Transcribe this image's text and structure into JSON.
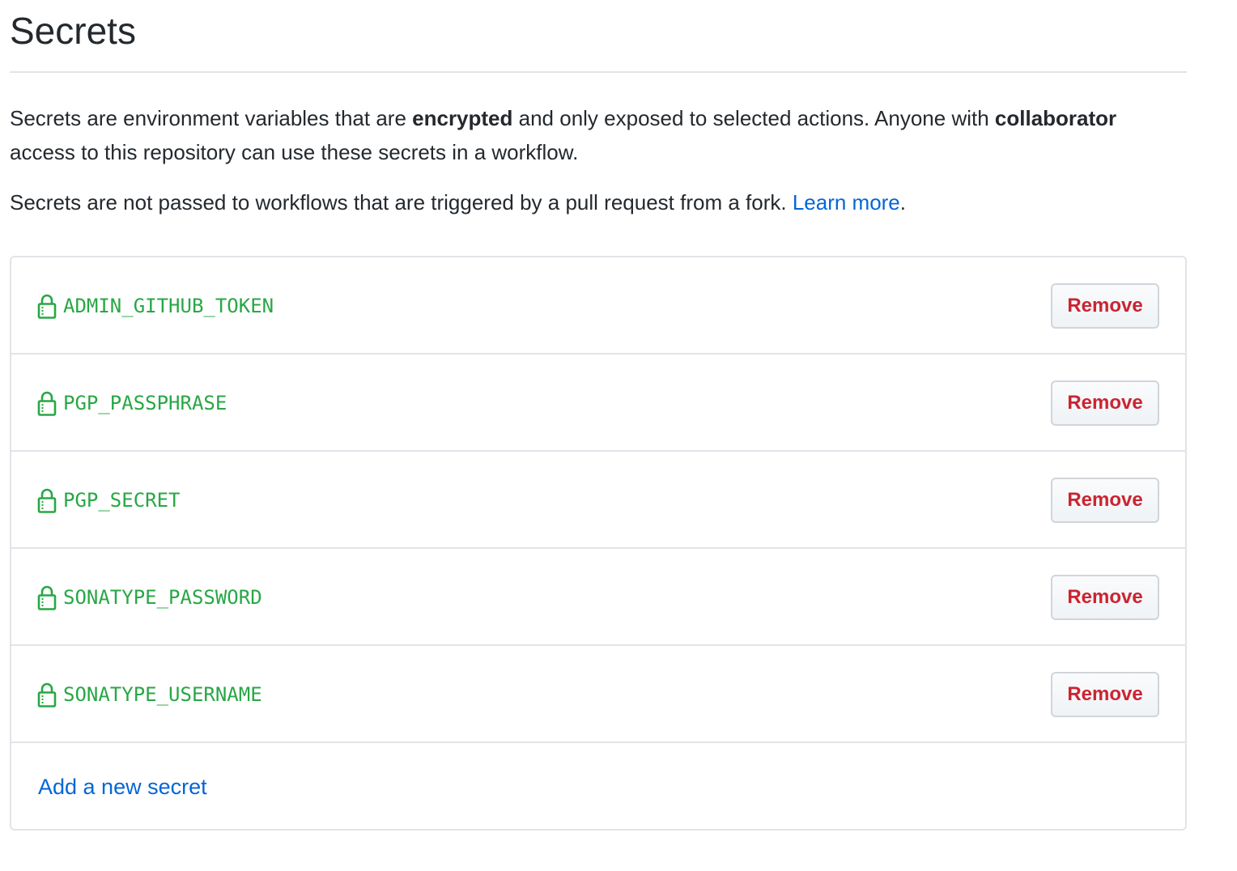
{
  "page": {
    "title": "Secrets"
  },
  "description": {
    "p1_part1": "Secrets are environment variables that are ",
    "p1_bold1": "encrypted",
    "p1_part2": " and only exposed to selected actions. Anyone with ",
    "p1_bold2": "collaborator",
    "p1_part3": " access to this repository can use these secrets in a workflow.",
    "p2_text": "Secrets are not passed to workflows that are triggered by a pull request from a fork. ",
    "p2_link": "Learn more",
    "p2_end": "."
  },
  "secrets": [
    {
      "name": "ADMIN_GITHUB_TOKEN",
      "remove_label": "Remove"
    },
    {
      "name": "PGP_PASSPHRASE",
      "remove_label": "Remove"
    },
    {
      "name": "PGP_SECRET",
      "remove_label": "Remove"
    },
    {
      "name": "SONATYPE_PASSWORD",
      "remove_label": "Remove"
    },
    {
      "name": "SONATYPE_USERNAME",
      "remove_label": "Remove"
    }
  ],
  "add_secret_label": "Add a new secret",
  "icons": {
    "secret_icon": "lock-icon"
  },
  "colors": {
    "secret_name": "#28a745",
    "remove_text": "#cb2431",
    "link": "#0366d6",
    "border": "#e1e4e8"
  }
}
